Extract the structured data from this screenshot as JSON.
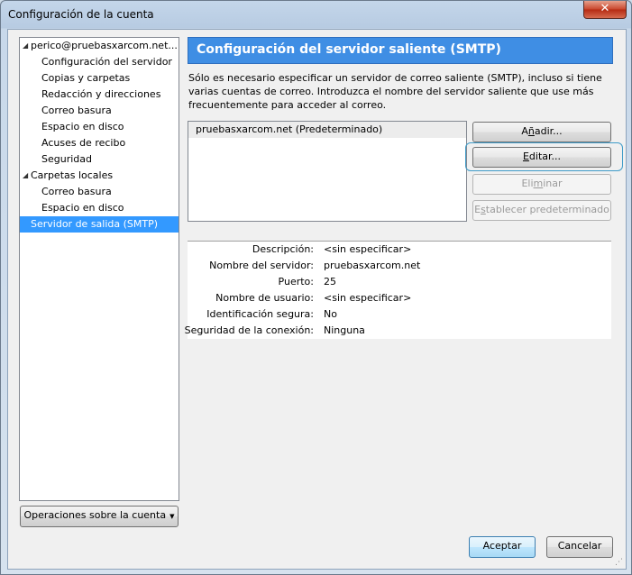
{
  "window": {
    "title": "Configuración de la cuenta",
    "close_glyph": "✕"
  },
  "tree": {
    "items": [
      {
        "label": "perico@pruebasxarcom.net...",
        "level": 0,
        "expanded": true
      },
      {
        "label": "Configuración del servidor",
        "level": 1
      },
      {
        "label": "Copias y carpetas",
        "level": 1
      },
      {
        "label": "Redacción y direcciones",
        "level": 1
      },
      {
        "label": "Correo basura",
        "level": 1
      },
      {
        "label": "Espacio en disco",
        "level": 1
      },
      {
        "label": "Acuses de recibo",
        "level": 1
      },
      {
        "label": "Seguridad",
        "level": 1
      },
      {
        "label": "Carpetas locales",
        "level": 0,
        "expanded": true
      },
      {
        "label": "Correo basura",
        "level": 1
      },
      {
        "label": "Espacio en disco",
        "level": 1
      },
      {
        "label": "Servidor de salida (SMTP)",
        "level": 0,
        "selected": true
      }
    ]
  },
  "ops_button": {
    "label": "Operaciones sobre la cuenta"
  },
  "panel": {
    "title": "Configuración del servidor saliente (SMTP)",
    "description": "Sólo es necesario especificar un servidor de correo saliente (SMTP), incluso si tiene varias cuentas de correo. Introduzca el nombre del servidor saliente que use más frecuentemente para acceder al correo.",
    "servers": [
      "pruebasxarcom.net (Predeterminado)"
    ],
    "buttons": {
      "add": {
        "pre": "A",
        "u": "ñ",
        "post": "adir..."
      },
      "edit": {
        "pre": "",
        "u": "E",
        "post": "ditar..."
      },
      "remove": {
        "pre": "Eli",
        "u": "m",
        "post": "inar"
      },
      "set_default": {
        "pre": "E",
        "u": "s",
        "post": "tablecer predeterminado"
      }
    },
    "details": [
      {
        "key": "Descripción:",
        "value": "<sin especificar>"
      },
      {
        "key": "Nombre del servidor:",
        "value": "pruebasxarcom.net"
      },
      {
        "key": "Puerto:",
        "value": "25"
      },
      {
        "key": "Nombre de usuario:",
        "value": "<sin especificar>"
      },
      {
        "key": "Identificación segura:",
        "value": "No"
      },
      {
        "key": "Seguridad de la conexión:",
        "value": "Ninguna"
      }
    ]
  },
  "footer": {
    "ok": "Aceptar",
    "cancel": "Cancelar"
  },
  "colors": {
    "selection": "#3399ff",
    "header": "#3f8ee4",
    "focus": "#3e9bc8"
  }
}
